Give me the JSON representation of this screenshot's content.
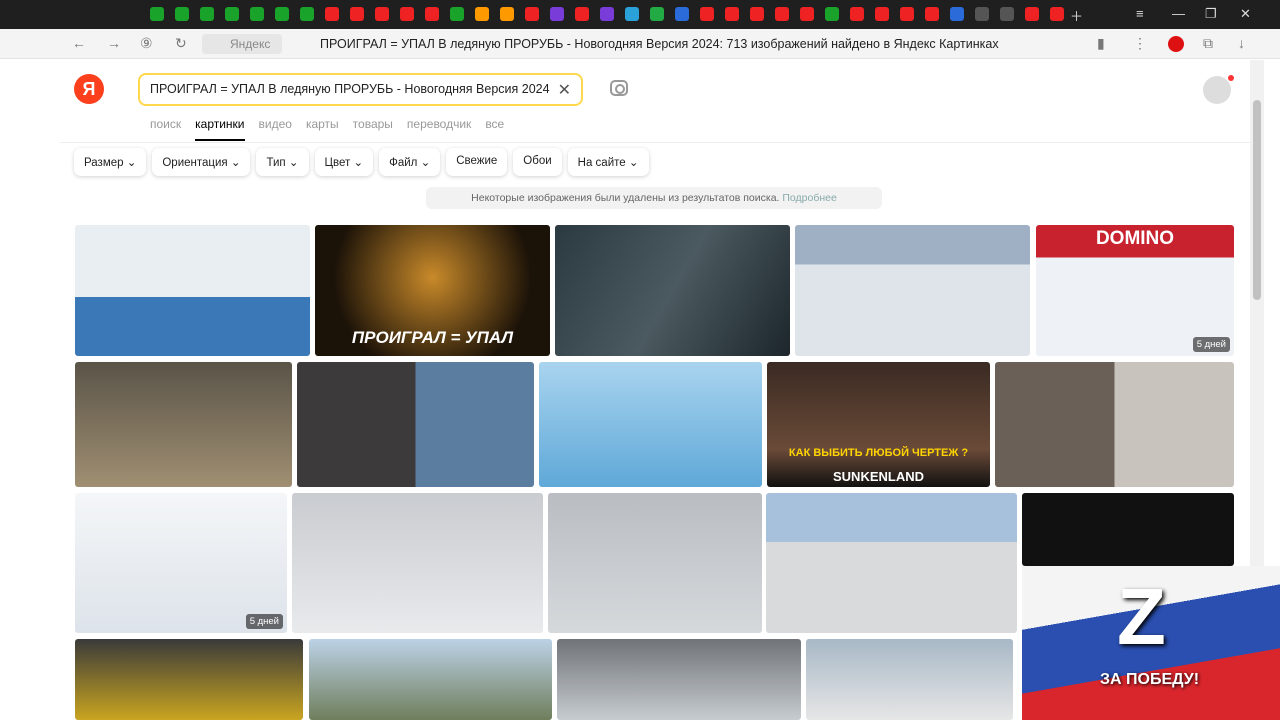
{
  "browser": {
    "host": "Яндекс",
    "page_title": "ПРОИГРАЛ = УПАЛ В ледяную ПРОРУБЬ - Новогодняя Версия 2024: 713 изображений найдено в Яндекс Картинках",
    "tab_colors": [
      "#1aa32a",
      "#1aa32a",
      "#1aa32a",
      "#1aa32a",
      "#1aa32a",
      "#1aa32a",
      "#1aa32a",
      "#e22",
      "#e22",
      "#e22",
      "#e22",
      "#e22",
      "#1aa32a",
      "#f90",
      "#f90",
      "#e22",
      "#7a3cd8",
      "#e22",
      "#7a3cd8",
      "#2aa1d9",
      "#2a4",
      "#2a6bd9",
      "#e22",
      "#e22",
      "#e22",
      "#e22",
      "#e22",
      "#1aa32a",
      "#e22",
      "#e22",
      "#e22",
      "#e22",
      "#2a6bd9",
      "#555",
      "#555",
      "#e22",
      "#e22"
    ]
  },
  "search": {
    "query": "ПРОИГРАЛ = УПАЛ В ледяную ПРОРУБЬ - Новогодняя Версия 2024"
  },
  "logo": "Я",
  "services": [
    "поиск",
    "картинки",
    "видео",
    "карты",
    "товары",
    "переводчик",
    "все"
  ],
  "filters": [
    "Размер ⌄",
    "Ориентация ⌄",
    "Тип ⌄",
    "Цвет ⌄",
    "Файл ⌄",
    "Свежие",
    "Обои",
    "На сайте ⌄"
  ],
  "notice": {
    "text": "Некоторые изображения были удалены из результатов поиска. ",
    "link": "Подробнее"
  },
  "images": {
    "cap1": "ПРОИГРАЛ = УПАЛ",
    "cap2": "DOMINO",
    "cap3": "КАК ВЫБИТЬ ЛЮБОЙ ЧЕРТЕЖ ?",
    "cap4": "SUNKENLAND",
    "badge": "5 дней"
  },
  "overlay": {
    "letter": "Z",
    "text": "ЗА ПОБЕДУ!"
  }
}
